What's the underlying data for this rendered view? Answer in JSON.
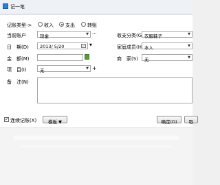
{
  "window": {
    "title": "记一笔"
  },
  "type_row": {
    "label": "记账类型->",
    "options": [
      {
        "label": "收入",
        "selected": false
      },
      {
        "label": "支出",
        "selected": true
      },
      {
        "label": "转账",
        "selected": false
      }
    ]
  },
  "account": {
    "label": "当前账户",
    "value": "现金",
    "more": "···"
  },
  "date": {
    "label": "日　期(D)",
    "value": "2013/ 5/20"
  },
  "amount": {
    "label": "金　额(M)",
    "value": ""
  },
  "project": {
    "label": "项　目(I)",
    "value": "无",
    "add": "+"
  },
  "notes": {
    "label": "备　注(N)",
    "value": ""
  },
  "category": {
    "label": "收支分类(G)",
    "value": "衣服鞋子"
  },
  "member": {
    "label": "家庭成员(H)",
    "value": "本人"
  },
  "merchant": {
    "label": "商　家(S)",
    "value": "无"
  },
  "footer": {
    "continuous_label": "连续记账(X)",
    "continuous_checked": true,
    "template_label": "模板 ▼",
    "ok_label": "确定(D)",
    "cancel_label": "取"
  },
  "colors": {
    "accent": "#1a3f8a",
    "title_bar": "#eef1f6",
    "dialog_bg": "#ffffff",
    "footer_bg": "#f4f4f4"
  }
}
